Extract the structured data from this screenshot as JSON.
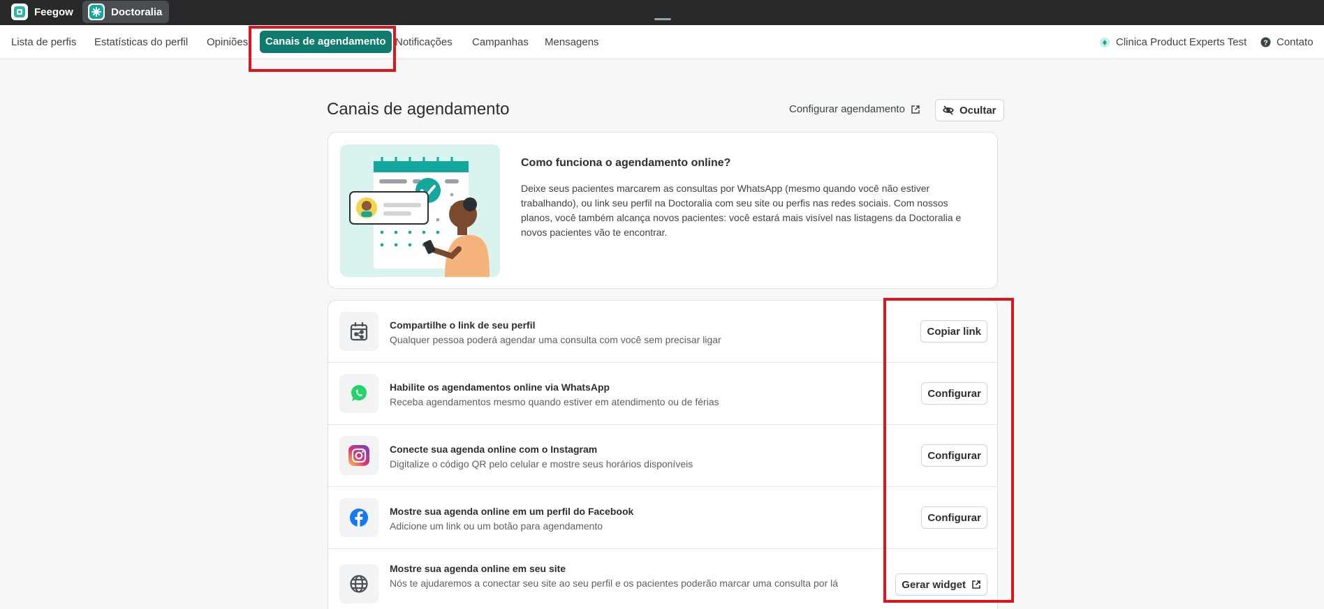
{
  "topbar": {
    "apps": [
      {
        "label": "Feegow",
        "icon": "feegow-logo-icon"
      },
      {
        "label": "Doctoralia",
        "icon": "doctoralia-logo-icon"
      }
    ]
  },
  "nav": {
    "items": [
      "Lista de perfis",
      "Estatísticas do perfil",
      "Opiniões",
      "Canais de agendamento",
      "Notificações",
      "Campanhas",
      "Mensagens"
    ],
    "active": "Canais de agendamento",
    "clinic": "Clinica Product Experts Test",
    "contact": "Contato"
  },
  "header": {
    "title": "Canais de agendamento",
    "config_link": "Configurar agendamento",
    "hide_button": "Ocultar"
  },
  "info": {
    "title": "Como funciona o agendamento online?",
    "text": "Deixe seus pacientes marcarem as consultas por WhatsApp (mesmo quando você não estiver trabalhando), ou link seu perfil na Doctoralia com seu site ou perfis nas redes sociais. Com nossos planos, você também alcança novos pacientes: você estará mais visível nas listagens da Doctoralia e novos pacientes vão te encontrar."
  },
  "channels": [
    {
      "title": "Compartilhe o link de seu perfil",
      "subtitle": "Qualquer pessoa poderá agendar uma consulta com você sem precisar ligar",
      "button": "Copiar link",
      "icon": "calendar-share-icon"
    },
    {
      "title": "Habilite os agendamentos online via WhatsApp",
      "subtitle": "Receba agendamentos mesmo quando estiver em atendimento ou de férias",
      "button": "Configurar",
      "icon": "whatsapp-icon"
    },
    {
      "title": "Conecte sua agenda online com o Instagram",
      "subtitle": "Digitalize o código QR pelo celular e mostre seus horários disponíveis",
      "button": "Configurar",
      "icon": "instagram-icon"
    },
    {
      "title": "Mostre sua agenda online em um perfil do Facebook",
      "subtitle": "Adicione um link ou um botão para agendamento",
      "button": "Configurar",
      "icon": "facebook-icon"
    },
    {
      "title": "Mostre sua agenda online em seu site",
      "subtitle": "Nós te ajudaremos a conectar seu site ao seu perfil e os pacientes poderão marcar uma consulta por lá",
      "button": "Gerar widget",
      "icon": "globe-icon"
    }
  ],
  "colors": {
    "accent": "#0f7b6c",
    "highlight": "#e3121b",
    "whatsapp": "#25d366",
    "facebook": "#1877f2"
  }
}
